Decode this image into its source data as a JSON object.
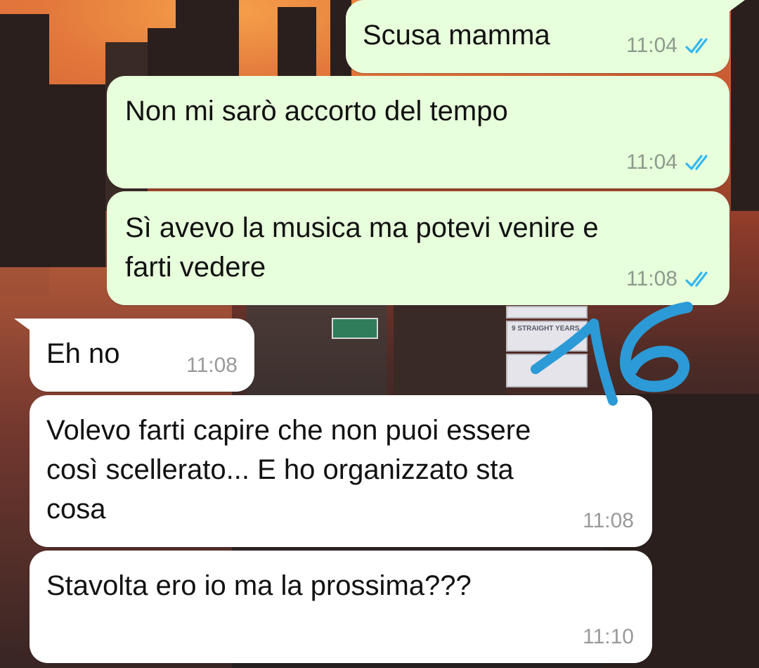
{
  "messages": [
    {
      "direction": "outgoing",
      "text": "Scusa mamma",
      "time": "11:04",
      "status": "read"
    },
    {
      "direction": "outgoing",
      "text": "Non mi sarò accorto del tempo",
      "time": "11:04",
      "status": "read"
    },
    {
      "direction": "outgoing",
      "text": "Sì avevo la musica ma potevi venire e\nfarti vedere",
      "time": "11:08",
      "status": "read"
    },
    {
      "direction": "incoming",
      "text": "Eh no",
      "time": "11:08"
    },
    {
      "direction": "incoming",
      "text": "Volevo farti capire che non puoi essere\ncosì scellerato... E ho organizzato sta\ncosa",
      "time": "11:08"
    },
    {
      "direction": "incoming",
      "text": "Stavolta ero io ma la prossima???",
      "time": "11:10"
    }
  ],
  "annotation": {
    "text": "16",
    "color": "#2b9ad6"
  },
  "background": {
    "billboard_text": "9 STRAIGHT YEARS"
  },
  "colors": {
    "outgoing_bubble": "#e7ffdb",
    "incoming_bubble": "#ffffff",
    "read_tick": "#34b7f1",
    "timestamp": "#8c9a8c"
  },
  "icons": {
    "read_receipt": "double-check-icon"
  }
}
